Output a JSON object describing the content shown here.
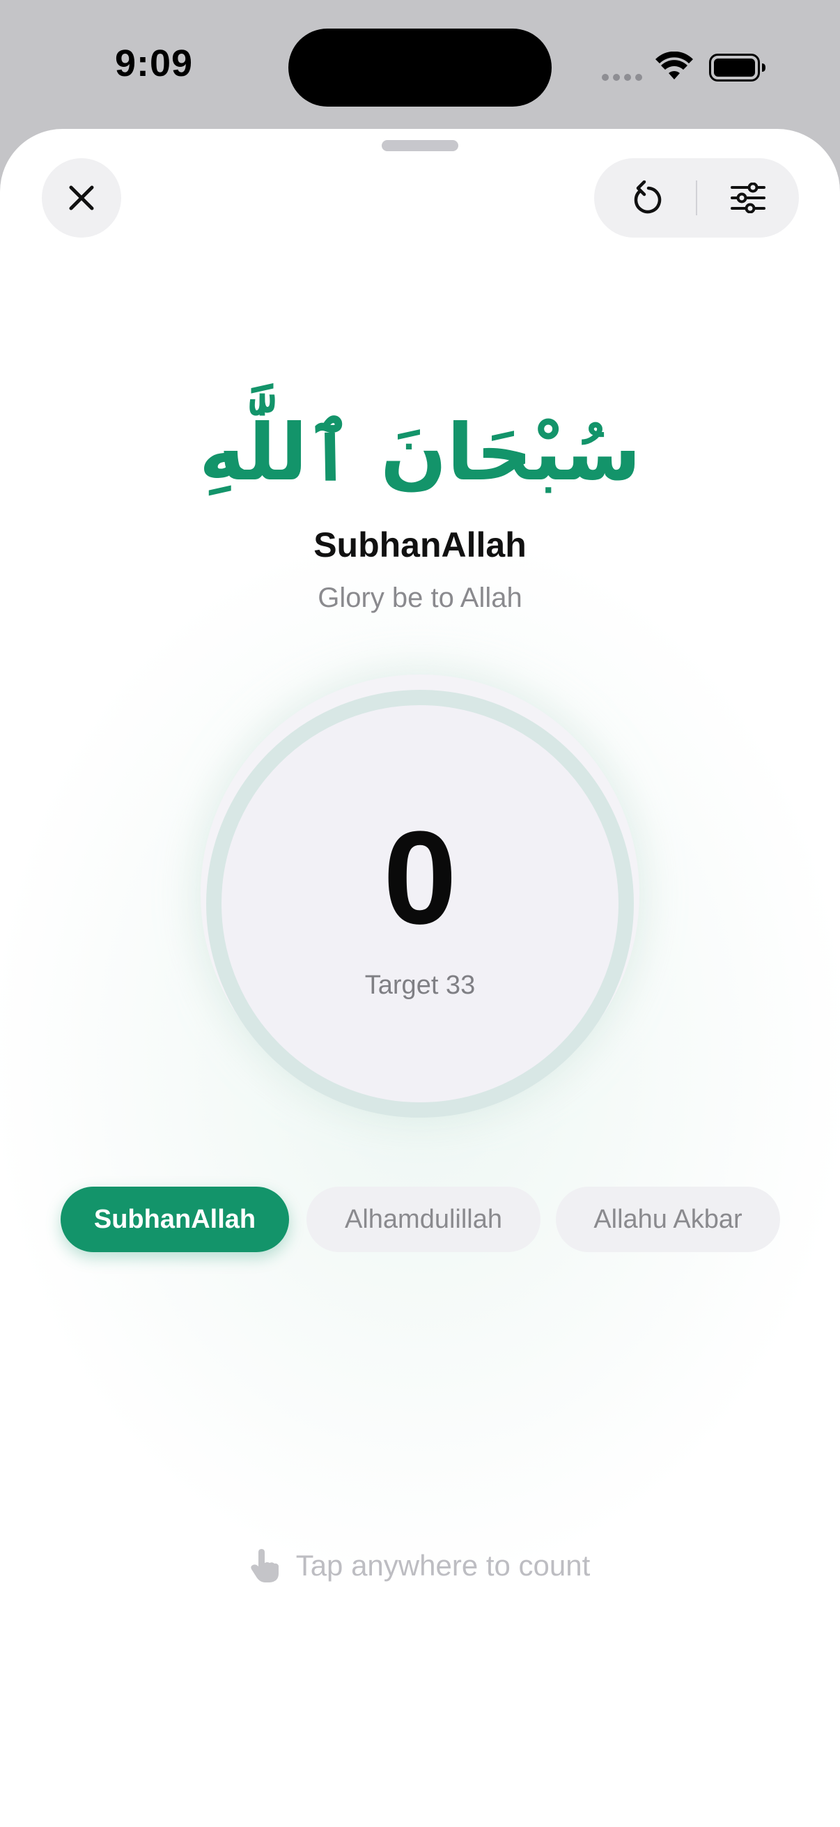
{
  "status_bar": {
    "time": "9:09",
    "signal_icon": "cellular-dots-icon",
    "wifi_icon": "wifi-icon",
    "battery_icon": "battery-full-icon"
  },
  "toolbar": {
    "close_icon": "close-icon",
    "reset_icon": "reset-icon",
    "settings_icon": "sliders-icon"
  },
  "dhikr": {
    "arabic": "سُبْحَانَ ٱللَّٰهِ",
    "name": "SubhanAllah",
    "translation": "Glory be to Allah"
  },
  "counter": {
    "value": "0",
    "target_label": "Target 33",
    "progress": 0
  },
  "chips": [
    {
      "label": "SubhanAllah",
      "selected": true
    },
    {
      "label": "Alhamdulillah",
      "selected": false
    },
    {
      "label": "Allahu Akbar",
      "selected": false
    }
  ],
  "hint": {
    "icon": "tap-hand-icon",
    "text": "Tap anywhere to count"
  },
  "colors": {
    "accent": "#13946a",
    "ring": "#d8e7e5",
    "chip_inactive": "#f0f0f3"
  }
}
